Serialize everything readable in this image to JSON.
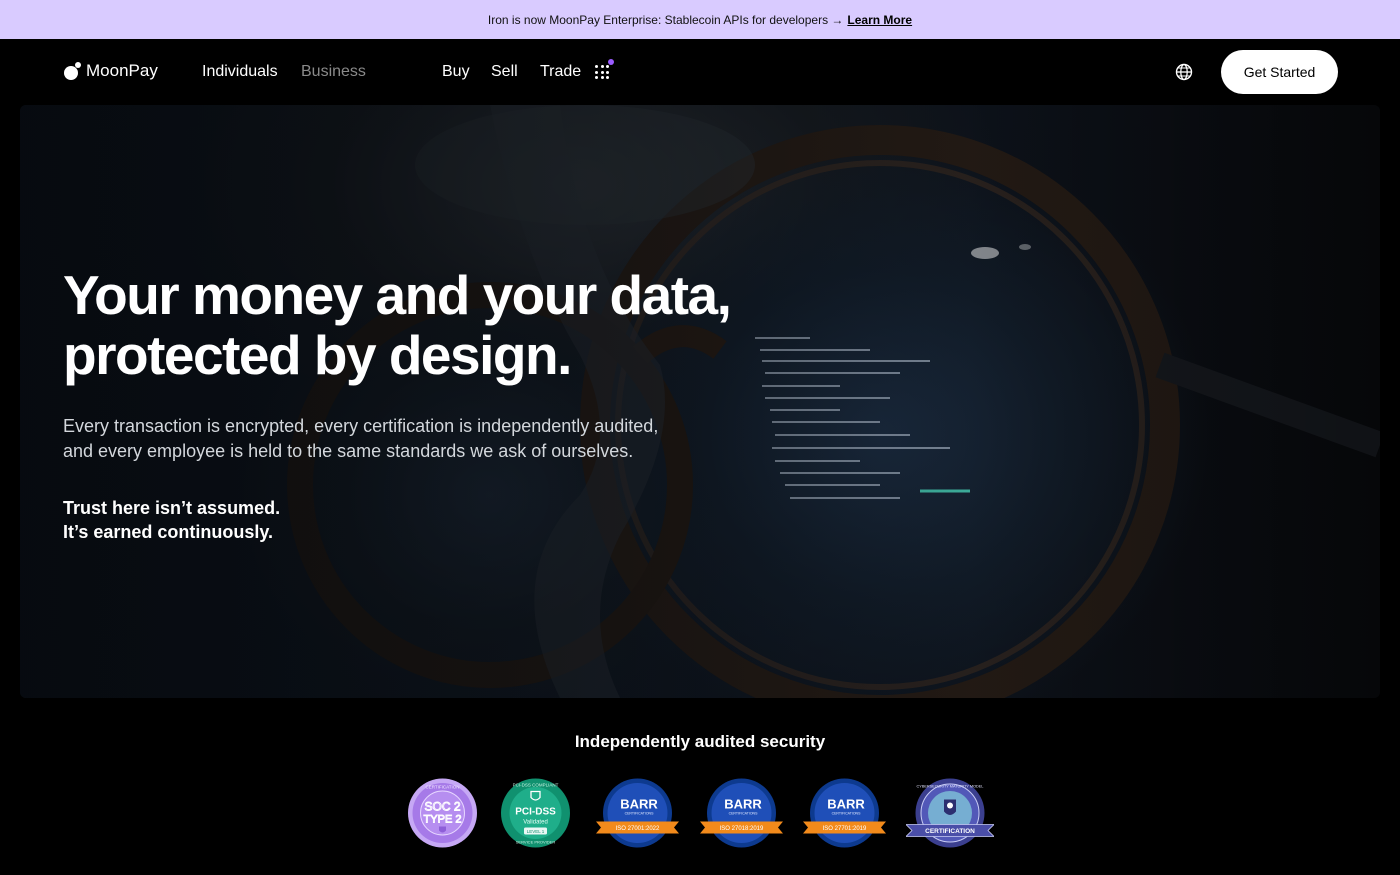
{
  "announcement": {
    "text": "Iron is now MoonPay Enterprise: Stablecoin APIs for developers →",
    "link": "Learn More"
  },
  "nav": {
    "brand": "MoonPay",
    "segments": [
      "Individuals",
      "Business"
    ],
    "links": [
      "Buy",
      "Sell",
      "Trade"
    ],
    "cta": "Get Started",
    "icons": [
      "moonpay-logo-icon",
      "apps-grid-icon",
      "globe-icon"
    ],
    "accent": "#9b5cff"
  },
  "hero": {
    "title_lines": [
      "Your money and your data,",
      "protected by design."
    ],
    "subtitle_lines": [
      "Every transaction is encrypted, every certification is independently audited,",
      "and every employee is held to the same standards we ask of ourselves."
    ],
    "trust_lines": [
      "Trust here isn’t assumed.",
      "It’s earned continuously."
    ]
  },
  "security": {
    "title": "Independently audited security",
    "badges": [
      {
        "icon": "soc2-badge-icon",
        "top_text": "CERTIFICATION",
        "lines": [
          "SOC 2",
          "TYPE 2"
        ],
        "color": "#b58cf0"
      },
      {
        "icon": "pci-dss-badge-icon",
        "top_text": "PCI-DSS COMPLIANT",
        "lines": [
          "PCI-DSS",
          "Validated",
          "LEVEL 1"
        ],
        "bottom_text": "SERVICE PROVIDER",
        "color": "#1fae8a"
      },
      {
        "icon": "barr-iso27001-badge-icon",
        "brand": "BARR",
        "sub": "CERTIFICATIONS",
        "ribbon": "ISO 27001:2022",
        "color": "#1f4fb8"
      },
      {
        "icon": "barr-iso27018-badge-icon",
        "brand": "BARR",
        "sub": "CERTIFICATIONS",
        "ribbon": "ISO 27018:2019",
        "color": "#1f4fb8"
      },
      {
        "icon": "barr-iso27701-badge-icon",
        "brand": "BARR",
        "sub": "CERTIFICATIONS",
        "ribbon": "ISO 27701:2019",
        "color": "#1f4fb8"
      },
      {
        "icon": "cmmc-badge-icon",
        "top_text": "CYBERSECURITY MATURITY MODEL",
        "ribbon": "CERTIFICATION",
        "color": "#4a4ea8"
      }
    ]
  }
}
